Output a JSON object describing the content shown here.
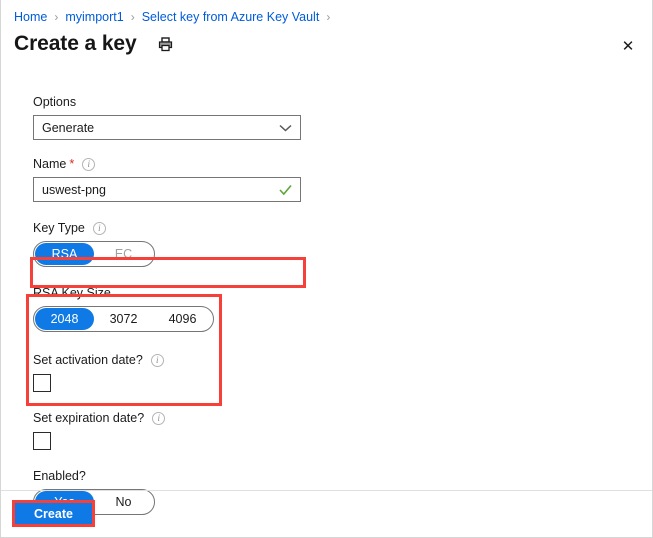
{
  "breadcrumb": {
    "items": [
      {
        "label": "Home"
      },
      {
        "label": "myimport1"
      },
      {
        "label": "Select key from Azure Key Vault"
      }
    ],
    "separator": "›"
  },
  "header": {
    "title": "Create a key",
    "print_icon": "printer-icon",
    "close_icon": "close-icon",
    "close_glyph": "✕"
  },
  "form": {
    "options": {
      "label": "Options",
      "value": "Generate",
      "chevron_icon": "chevron-down-icon"
    },
    "name": {
      "label": "Name",
      "required_marker": "*",
      "value": "uswest-png",
      "valid_icon": "checkmark-icon"
    },
    "key_type": {
      "label": "Key Type",
      "options": [
        "RSA",
        "EC"
      ],
      "selected": "RSA"
    },
    "rsa_key_size": {
      "label": "RSA Key Size",
      "options": [
        "2048",
        "3072",
        "4096"
      ],
      "selected": "2048"
    },
    "set_activation_date": {
      "label": "Set activation date?",
      "checked": false
    },
    "set_expiration_date": {
      "label": "Set expiration date?",
      "checked": false
    },
    "enabled": {
      "label": "Enabled?",
      "options": [
        "Yes",
        "No"
      ],
      "selected": "Yes"
    }
  },
  "footer": {
    "create_label": "Create"
  },
  "colors": {
    "accent_blue": "#0f7ae5",
    "link_blue": "#015cda",
    "annotation_red": "#f6413a",
    "valid_green": "#5ca63c",
    "required_red": "#d62c20"
  }
}
